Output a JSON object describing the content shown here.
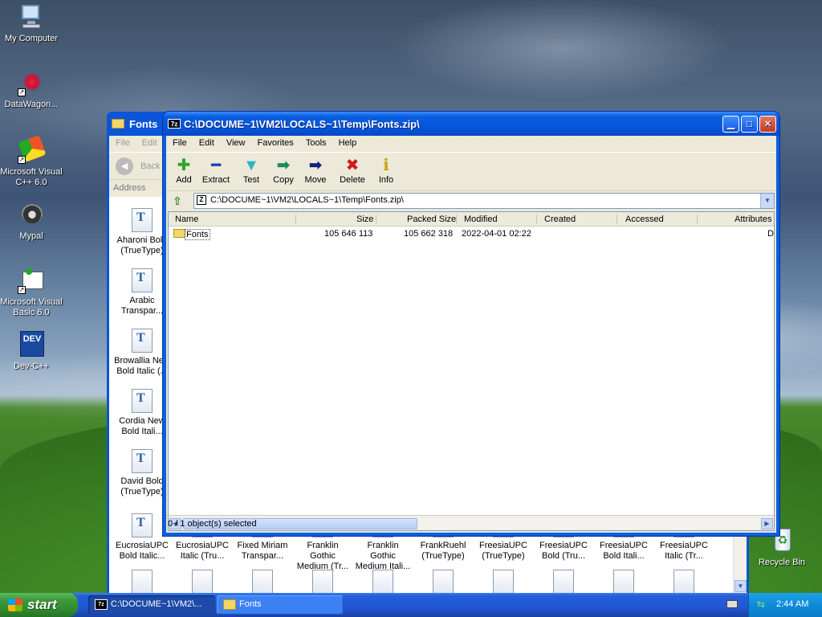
{
  "desktop": {
    "icons": [
      {
        "label": "My Computer"
      },
      {
        "label": "DataWagon..."
      },
      {
        "label": "Microsoft Visual C++ 6.0"
      },
      {
        "label": "Mypal"
      },
      {
        "label": "Microsoft Visual Basic 6.0"
      },
      {
        "label": "Dev-C++"
      },
      {
        "label": "Recycle Bin"
      }
    ],
    "devcpp_icon_text": "DEV"
  },
  "fonts_window": {
    "title": "Fonts",
    "menu": [
      "File",
      "Edit"
    ],
    "back_label": "Back",
    "address_label": "Address",
    "items": [
      {
        "label": "Aharoni Bold (TrueType)",
        "icon": "T"
      },
      {
        "label": "Arabic Transpar...",
        "icon": "T"
      },
      {
        "label": "Browallia New Bold Italic (...",
        "icon": "T"
      },
      {
        "label": "Cordia New Bold Itali...",
        "icon": "T"
      },
      {
        "label": "David Bold (TrueType)",
        "icon": "T"
      },
      {
        "label": "EucrosiaUPC Bold Italic...",
        "icon": "T"
      },
      {
        "label": "EucrosiaUPC Italic (Tru...",
        "icon": "O"
      },
      {
        "label": "Fixed Miriam Transpar...",
        "icon": "O"
      },
      {
        "label": "Franklin Gothic Medium (Tr...",
        "icon": "O"
      },
      {
        "label": "Franklin Gothic Medium Itali...",
        "icon": "O"
      },
      {
        "label": "FrankRuehl (TrueType)",
        "icon": "O"
      },
      {
        "label": "FreesiaUPC (TrueType)",
        "icon": "A"
      },
      {
        "label": "FreesiaUPC Bold (Tru...",
        "icon": "A"
      },
      {
        "label": "FreesiaUPC Bold Itali...",
        "icon": "A"
      },
      {
        "label": "FreesiaUPC Italic (Tr...",
        "icon": "A"
      }
    ]
  },
  "zip_window": {
    "title": "C:\\DOCUME~1\\VM2\\LOCALS~1\\Temp\\Fonts.zip\\",
    "app_icon": "7z",
    "menu": [
      "File",
      "Edit",
      "View",
      "Favorites",
      "Tools",
      "Help"
    ],
    "toolbar": [
      {
        "label": "Add",
        "glyph": "✚",
        "color": "#2aa42a"
      },
      {
        "label": "Extract",
        "glyph": "━",
        "color": "#1b3fb5"
      },
      {
        "label": "Test",
        "glyph": "▼",
        "color": "#2bb5c0"
      },
      {
        "label": "Copy",
        "glyph": "➡",
        "color": "#1d8a5a"
      },
      {
        "label": "Move",
        "glyph": "➡",
        "color": "#12207a"
      },
      {
        "label": "Delete",
        "glyph": "✖",
        "color": "#d11a1a"
      },
      {
        "label": "Info",
        "glyph": "ℹ",
        "color": "#c8a40a"
      }
    ],
    "address": "C:\\DOCUME~1\\VM2\\LOCALS~1\\Temp\\Fonts.zip\\",
    "columns": [
      "Name",
      "Size",
      "Packed Size",
      "Modified",
      "Created",
      "Accessed",
      "Attributes"
    ],
    "rows": [
      {
        "name": "Fonts",
        "size": "105 646 113",
        "packed": "105 662 318",
        "modified": "2022-04-01 02:22",
        "created": "",
        "accessed": "",
        "attributes": "D"
      }
    ],
    "status": "0 / 1 object(s) selected"
  },
  "taskbar": {
    "start_label": "start",
    "tasks": [
      {
        "label": "C:\\DOCUME~1\\VM2\\...",
        "active": true
      },
      {
        "label": "Fonts",
        "active": false
      }
    ],
    "clock": "2:44 AM"
  },
  "colors": {
    "xp_blue": "#0b5fe0",
    "start_green": "#3c9a3c",
    "window_face": "#ece9d8"
  }
}
